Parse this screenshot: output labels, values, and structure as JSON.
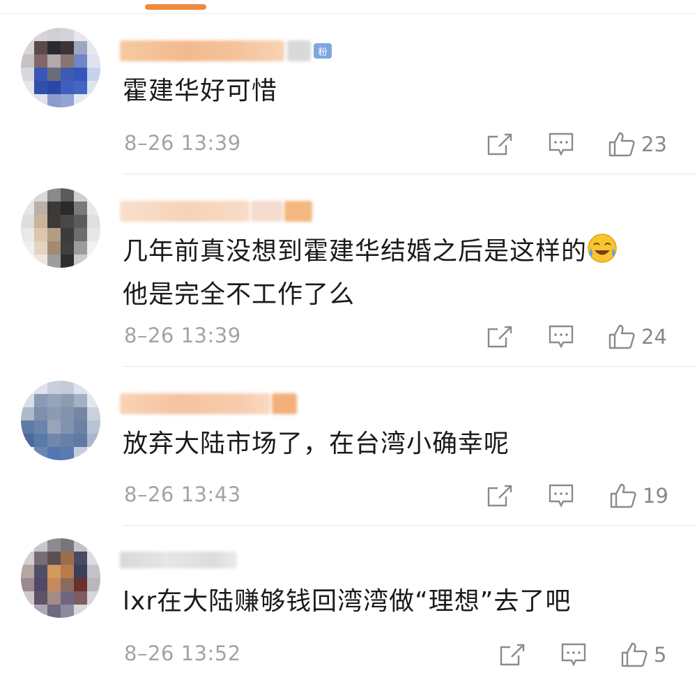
{
  "colors": {
    "accent": "#f08a3c",
    "time": "#a3a3a3",
    "text": "#1a1a1a"
  },
  "comments": [
    {
      "text": "霍建华好可惜",
      "time": "8–26 13:39",
      "likes": "23",
      "badge": "粉"
    },
    {
      "text_line1": "几年前真没想到霍建华结婚之后是这样的",
      "text_line2": "他是完全不工作了么",
      "emoji": "face-with-tears-of-joy",
      "time": "8–26 13:39",
      "likes": "24"
    },
    {
      "text": "放弃大陆市场了，在台湾小确幸呢",
      "time": "8–26 13:43",
      "likes": "19"
    },
    {
      "text": "lxr在大陆赚够钱回湾湾做“理想”去了吧",
      "time": "8–26 13:52",
      "likes": "5"
    }
  ],
  "icons": {
    "share": "share-external-icon",
    "reply": "comment-icon",
    "like": "thumbs-up-icon"
  }
}
